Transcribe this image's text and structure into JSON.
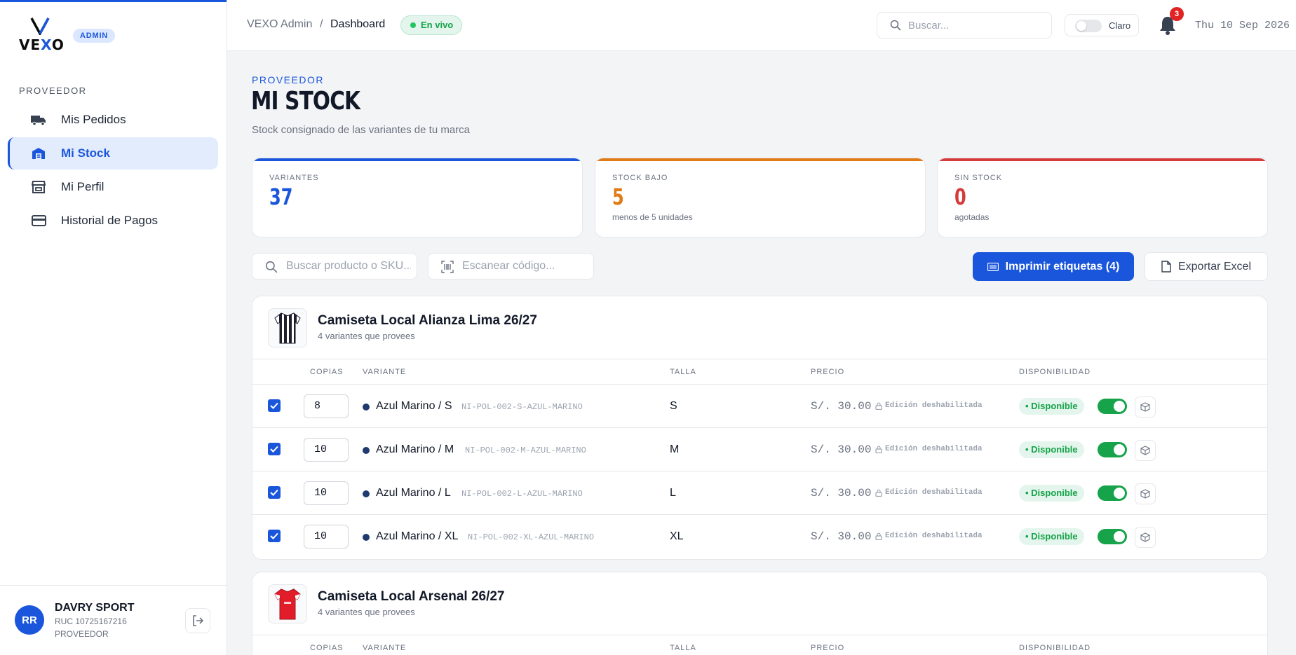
{
  "brand": {
    "logo_mark": "V",
    "logo_text_1": "VE",
    "logo_text_x": "X",
    "logo_text_2": "O",
    "role_badge": "ADMIN"
  },
  "sidebar": {
    "section_label": "PROVEEDOR",
    "items": [
      {
        "label": "Mis Pedidos",
        "icon": "truck-icon",
        "active": false
      },
      {
        "label": "Mi Stock",
        "icon": "warehouse-icon",
        "active": true
      },
      {
        "label": "Mi Perfil",
        "icon": "store-icon",
        "active": false
      },
      {
        "label": "Historial de Pagos",
        "icon": "credit-card-icon",
        "active": false
      }
    ],
    "user": {
      "initials": "RR",
      "name": "DAVRY SPORT",
      "ruc": "RUC 10725167216",
      "role": "PROVEEDOR"
    }
  },
  "header": {
    "breadcrumb_root": "VEXO Admin",
    "breadcrumb_sep": "/",
    "breadcrumb_current": "Dashboard",
    "live_badge": "En vivo",
    "search_placeholder": "Buscar...",
    "theme_label": "Claro",
    "notification_count": "3",
    "date": "Thu 10 Sep 2026"
  },
  "page": {
    "kicker": "PROVEEDOR",
    "title": "MI STOCK",
    "subtitle": "Stock consignado de las variantes de tu marca"
  },
  "stats": [
    {
      "label": "VARIANTES",
      "value": "37",
      "note": "",
      "color": "#1a56db"
    },
    {
      "label": "STOCK BAJO",
      "value": "5",
      "note": "menos de 5 unidades",
      "color": "#e07b16"
    },
    {
      "label": "SIN STOCK",
      "value": "0",
      "note": "agotadas",
      "color": "#d63b3b"
    }
  ],
  "toolbar": {
    "search_placeholder": "Buscar producto o SKU...",
    "scan_placeholder": "Escanear código...",
    "print_label": "Imprimir etiquetas (4)",
    "export_label": "Exportar Excel"
  },
  "table_headers": {
    "copies": "COPIAS",
    "variant": "VARIANTE",
    "size": "TALLA",
    "price": "PRECIO",
    "availability": "DISPONIBILIDAD"
  },
  "products": [
    {
      "name": "Camiseta Local Alianza Lima 26/27",
      "sub": "4 variantes que provees",
      "rows": [
        {
          "copies": "8",
          "variant": "Azul Marino / S",
          "sku": "NI-POL-002-S-AZUL-MARINO",
          "size": "S",
          "price": "S/. 30.00",
          "lock": "Edición deshabilitada",
          "status": "• Disponible"
        },
        {
          "copies": "10",
          "variant": "Azul Marino / M",
          "sku": "NI-POL-002-M-AZUL-MARINO",
          "size": "M",
          "price": "S/. 30.00",
          "lock": "Edición deshabilitada",
          "status": "• Disponible"
        },
        {
          "copies": "10",
          "variant": "Azul Marino / L",
          "sku": "NI-POL-002-L-AZUL-MARINO",
          "size": "L",
          "price": "S/. 30.00",
          "lock": "Edición deshabilitada",
          "status": "• Disponible"
        },
        {
          "copies": "10",
          "variant": "Azul Marino / XL",
          "sku": "NI-POL-002-XL-AZUL-MARINO",
          "size": "XL",
          "price": "S/. 30.00",
          "lock": "Edición deshabilitada",
          "status": "• Disponible"
        }
      ]
    },
    {
      "name": "Camiseta Local Arsenal 26/27",
      "sub": "4 variantes que provees",
      "rows": []
    }
  ]
}
